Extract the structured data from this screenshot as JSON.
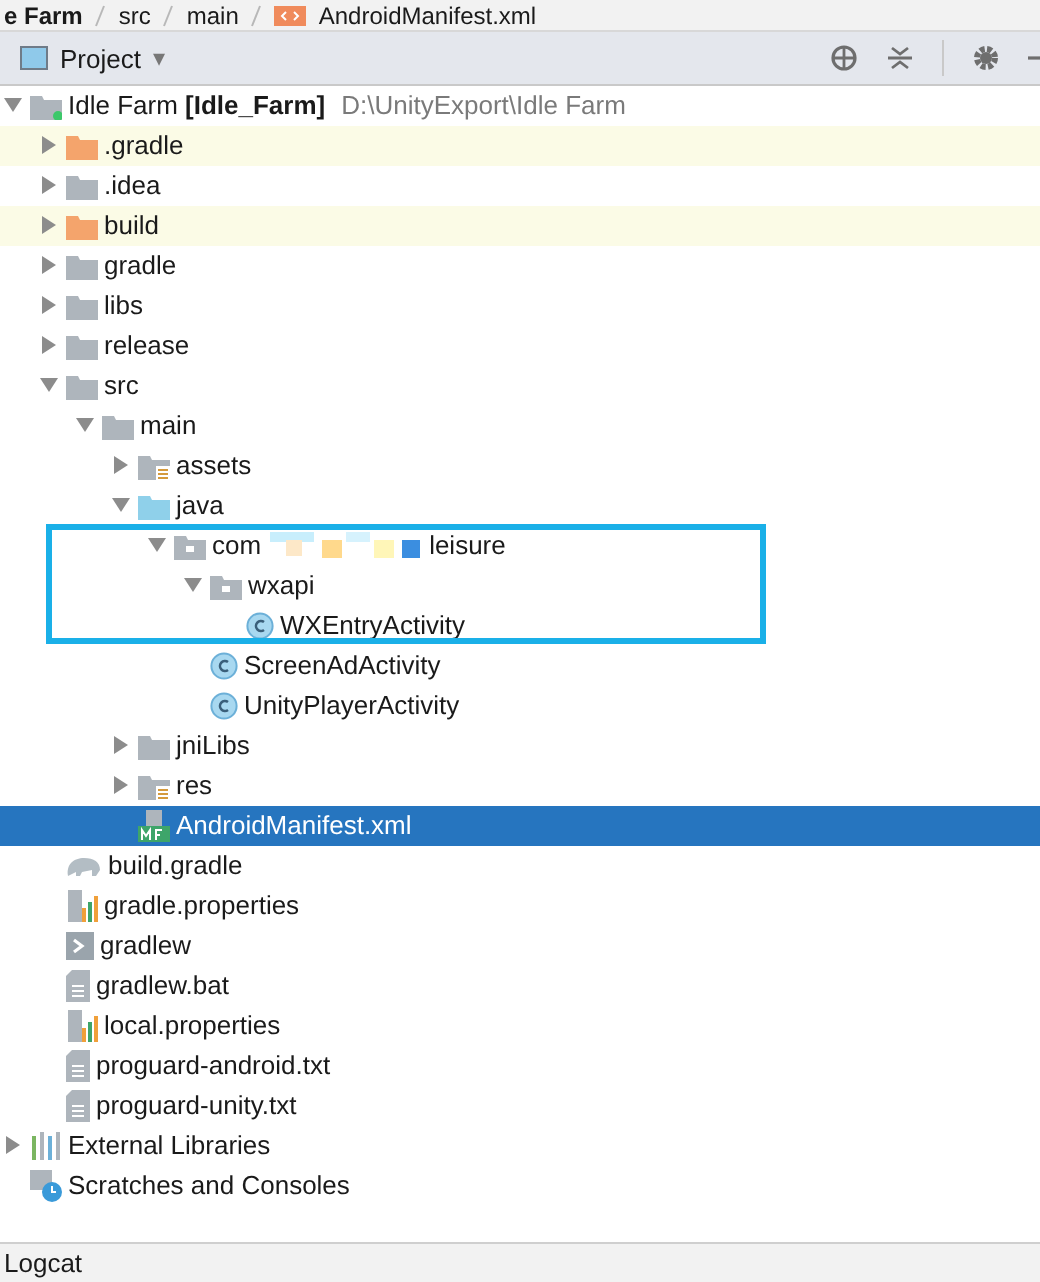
{
  "breadcrumbs": [
    {
      "label": "e Farm",
      "kind": "folder"
    },
    {
      "label": "src",
      "kind": "folder"
    },
    {
      "label": "main",
      "kind": "folder"
    },
    {
      "label": "AndroidManifest.xml",
      "kind": "xml"
    }
  ],
  "toolbar": {
    "title": "Project",
    "dropdown": "▾"
  },
  "tree": [
    {
      "label": "Idle Farm **[Idle_Farm]**",
      "path": "D:\\UnityExport\\Idle Farm",
      "kind": "module",
      "expanded": true,
      "selected": false,
      "excluded": false,
      "children": [
        {
          "label": ".gradle",
          "kind": "folder-excluded",
          "expanded": false,
          "selected": false,
          "excluded": true
        },
        {
          "label": ".idea",
          "kind": "folder",
          "expanded": false,
          "selected": false,
          "excluded": false
        },
        {
          "label": "build",
          "kind": "folder-excluded",
          "expanded": false,
          "selected": false,
          "excluded": true
        },
        {
          "label": "gradle",
          "kind": "folder",
          "expanded": false,
          "selected": false,
          "excluded": false
        },
        {
          "label": "libs",
          "kind": "folder",
          "expanded": false,
          "selected": false,
          "excluded": false
        },
        {
          "label": "release",
          "kind": "folder",
          "expanded": false,
          "selected": false,
          "excluded": false
        },
        {
          "label": "src",
          "kind": "folder",
          "expanded": true,
          "selected": false,
          "excluded": false,
          "children": [
            {
              "label": "main",
              "kind": "folder",
              "expanded": true,
              "selected": false,
              "excluded": false,
              "children": [
                {
                  "label": "assets",
                  "kind": "folder-resources",
                  "expanded": false,
                  "selected": false,
                  "excluded": false
                },
                {
                  "label": "java",
                  "kind": "folder-source",
                  "expanded": true,
                  "selected": false,
                  "excluded": false,
                  "children": [
                    {
                      "label": "com",
                      "label_end": "leisure",
                      "kind": "package",
                      "expanded": true,
                      "selected": false,
                      "excluded": false,
                      "children": [
                        {
                          "label": "wxapi",
                          "kind": "package",
                          "expanded": true,
                          "selected": false,
                          "excluded": false,
                          "children": [
                            {
                              "label": "WXEntryActivity",
                              "kind": "class",
                              "selected": false,
                              "excluded": false
                            }
                          ]
                        },
                        {
                          "label": "ScreenAdActivity",
                          "kind": "class",
                          "selected": false,
                          "excluded": false
                        },
                        {
                          "label": "UnityPlayerActivity",
                          "kind": "class",
                          "selected": false,
                          "excluded": false
                        }
                      ]
                    }
                  ]
                },
                {
                  "label": "jniLibs",
                  "kind": "folder",
                  "expanded": false,
                  "selected": false,
                  "excluded": false
                },
                {
                  "label": "res",
                  "kind": "folder-resources",
                  "expanded": false,
                  "selected": false,
                  "excluded": false
                },
                {
                  "label": "AndroidManifest.xml",
                  "kind": "manifest",
                  "selected": true,
                  "excluded": false
                }
              ]
            }
          ]
        },
        {
          "label": "build.gradle",
          "kind": "gradle",
          "selected": false,
          "excluded": false
        },
        {
          "label": "gradle.properties",
          "kind": "properties",
          "selected": false,
          "excluded": false
        },
        {
          "label": "gradlew",
          "kind": "shell",
          "selected": false,
          "excluded": false
        },
        {
          "label": "gradlew.bat",
          "kind": "text",
          "selected": false,
          "excluded": false
        },
        {
          "label": "local.properties",
          "kind": "properties",
          "selected": false,
          "excluded": false
        },
        {
          "label": "proguard-android.txt",
          "kind": "text",
          "selected": false,
          "excluded": false
        },
        {
          "label": "proguard-unity.txt",
          "kind": "text",
          "selected": false,
          "excluded": false
        }
      ]
    },
    {
      "label": "External Libraries",
      "kind": "libraries",
      "expanded": false,
      "selected": false,
      "excluded": false
    },
    {
      "label": "Scratches and Consoles",
      "kind": "scratches",
      "selected": false,
      "excluded": false
    }
  ],
  "bottom_bar": {
    "tab": "Logcat"
  }
}
